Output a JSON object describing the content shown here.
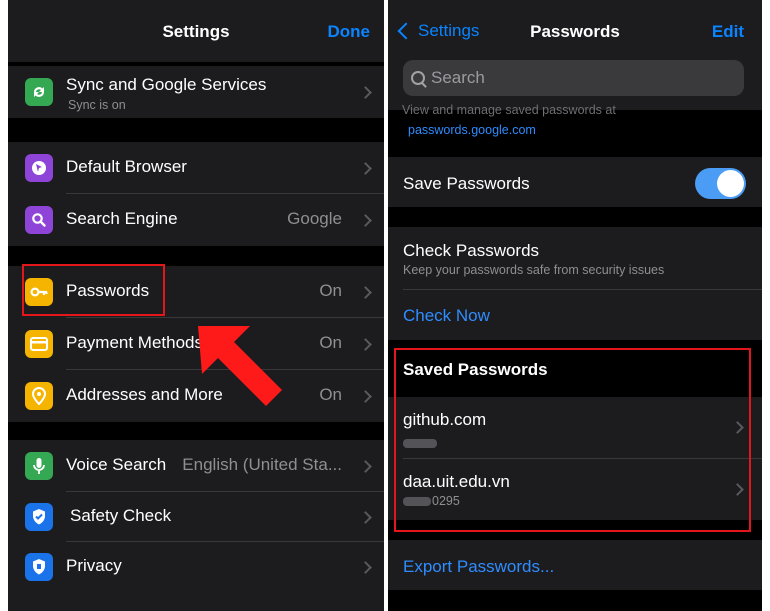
{
  "left": {
    "title": "Settings",
    "done": "Done",
    "sync": {
      "label": "Sync and Google Services",
      "sub": "Sync is on"
    },
    "items1": [
      {
        "label": "Default Browser",
        "value": ""
      },
      {
        "label": "Search Engine",
        "value": "Google"
      }
    ],
    "items2": [
      {
        "label": "Passwords",
        "value": "On"
      },
      {
        "label": "Payment Methods",
        "value": "On"
      },
      {
        "label": "Addresses and More",
        "value": "On"
      }
    ],
    "items3": [
      {
        "label": "Voice Search",
        "value": "English (United Sta..."
      },
      {
        "label": "Safety Check",
        "value": ""
      },
      {
        "label": "Privacy",
        "value": ""
      }
    ],
    "colors": {
      "sync": "#34a853",
      "browser": "#8e44d6",
      "search": "#8e44d6",
      "passwords": "#f5b400",
      "payment": "#f5b400",
      "addresses": "#f5b400",
      "voice": "#34a853",
      "safety": "#1a73e8",
      "privacy": "#1a73e8"
    }
  },
  "right": {
    "back": "Settings",
    "title": "Passwords",
    "edit": "Edit",
    "search_placeholder": "Search",
    "manage_text": "View and manage saved passwords at",
    "manage_link": "passwords.google.com",
    "save_passwords": "Save Passwords",
    "save_passwords_on": true,
    "check_title": "Check Passwords",
    "check_sub": "Keep your passwords safe from security issues",
    "check_now": "Check Now",
    "saved_header": "Saved Passwords",
    "entries": [
      {
        "site": "github.com",
        "user": ""
      },
      {
        "site": "daa.uit.edu.vn",
        "user": "0295"
      }
    ],
    "export": "Export Passwords..."
  }
}
